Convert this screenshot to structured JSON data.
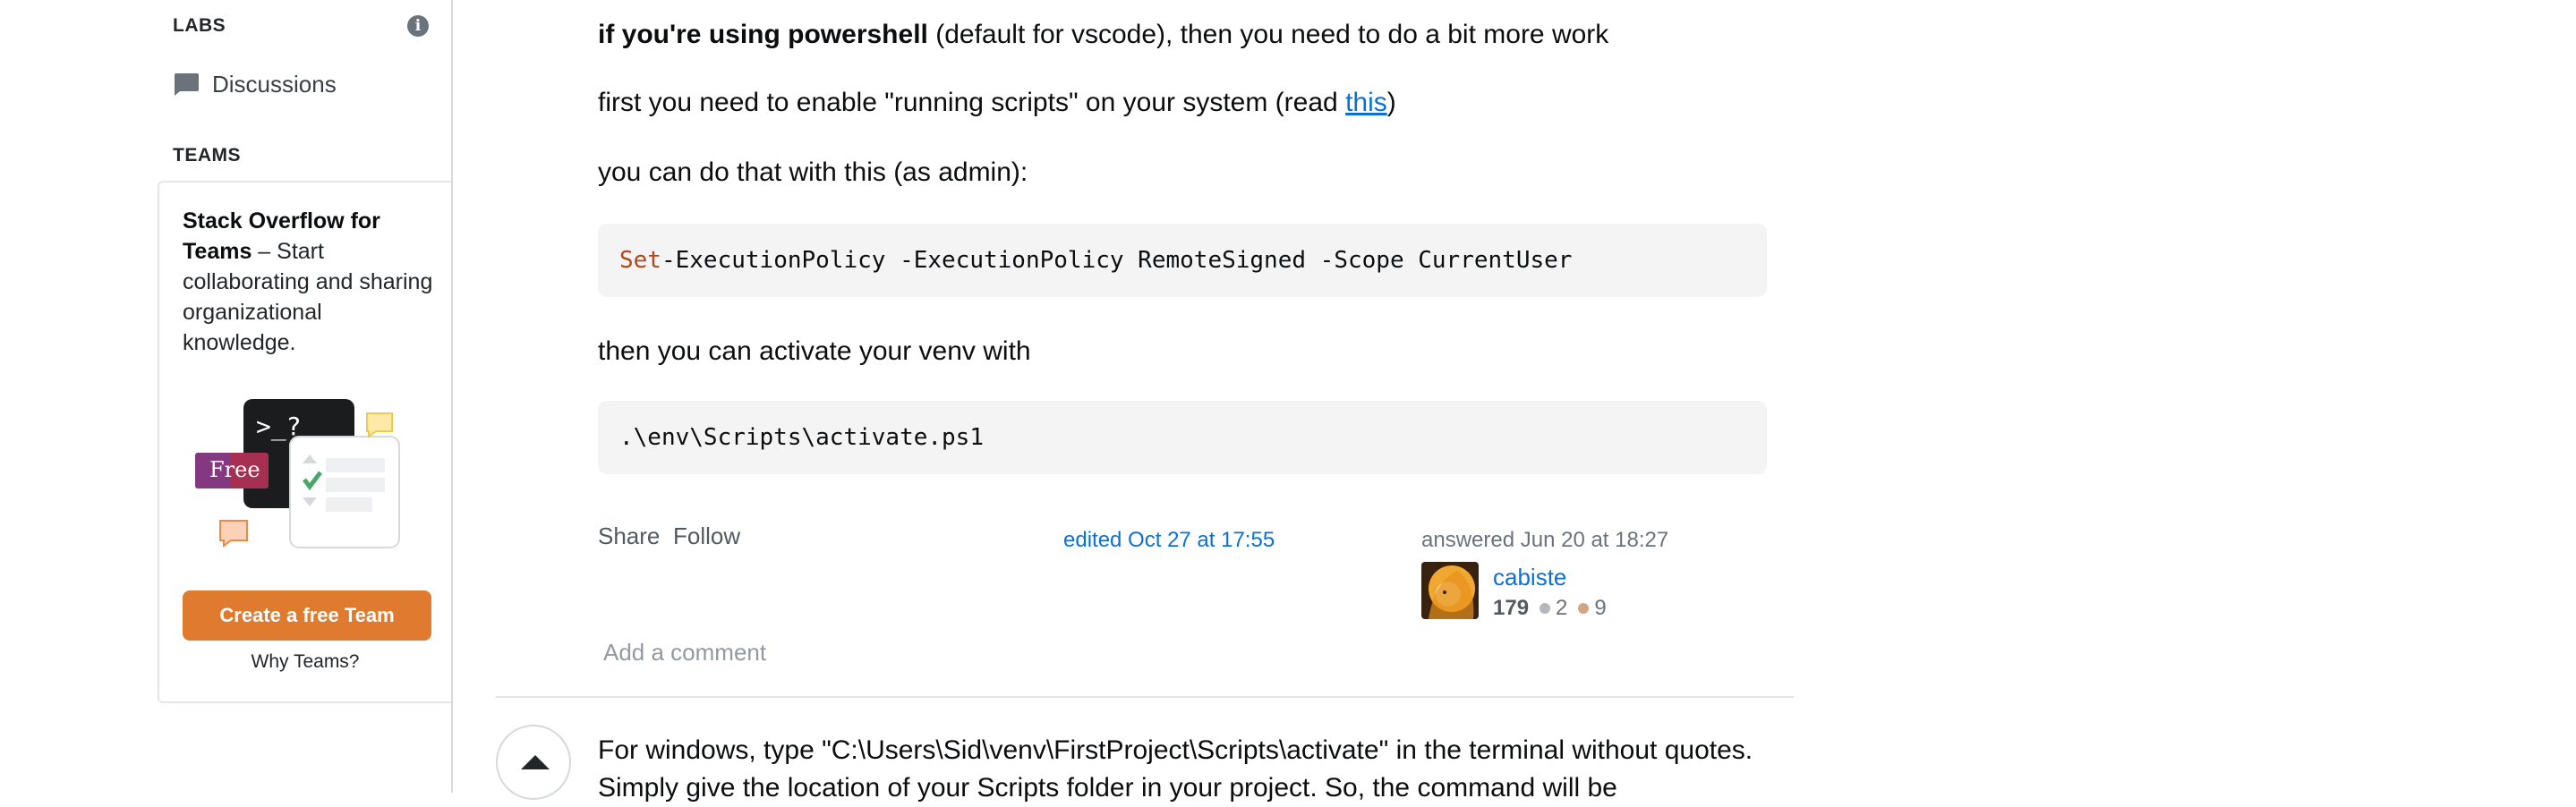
{
  "sidebar": {
    "labs_heading": "LABS",
    "discussions_label": "Discussions",
    "teams_heading": "TEAMS",
    "teams_title": "Stack Overflow for Teams",
    "teams_desc": " – Start collaborating and sharing organizational knowledge.",
    "illustration_prompt": ">_?",
    "free_badge": "Free",
    "create_team_button": "Create a free Team",
    "why_teams_link": "Why Teams?"
  },
  "answer": {
    "p1_bold": "if you're using powershell",
    "p1_rest": " (default for vscode), then you need to do a bit more work",
    "p2_text": "first you need to enable \"running scripts\" on your system (read ",
    "p2_link": "this",
    "p2_end": ")",
    "p3_text": "you can do that with this (as admin):",
    "code1_kw": "Set",
    "code1_rest": "-ExecutionPolicy -ExecutionPolicy RemoteSigned -Scope CurrentUser",
    "p4_text": "then you can activate your venv with",
    "code2": ".\\env\\Scripts\\activate.ps1",
    "share_label": "Share",
    "follow_label": "Follow",
    "edited_text": "edited Oct 27 at 17:55",
    "answered_text": "answered Jun 20 at 18:27",
    "user_name": "cabiste",
    "user_rep": "179",
    "silver_badges": "2",
    "bronze_badges": "9",
    "add_comment": "Add a comment"
  },
  "next_answer": {
    "text": "For windows, type \"C:\\Users\\Sid\\venv\\FirstProject\\Scripts\\activate\" in the terminal without quotes. Simply give the location of your Scripts folder in your project. So, the command will be"
  },
  "colors": {
    "link": "#0a70d6",
    "orange_button": "#e07a2e",
    "code_bg": "#f4f4f5",
    "silver": "#b4b8bc",
    "bronze": "#d1a684"
  }
}
